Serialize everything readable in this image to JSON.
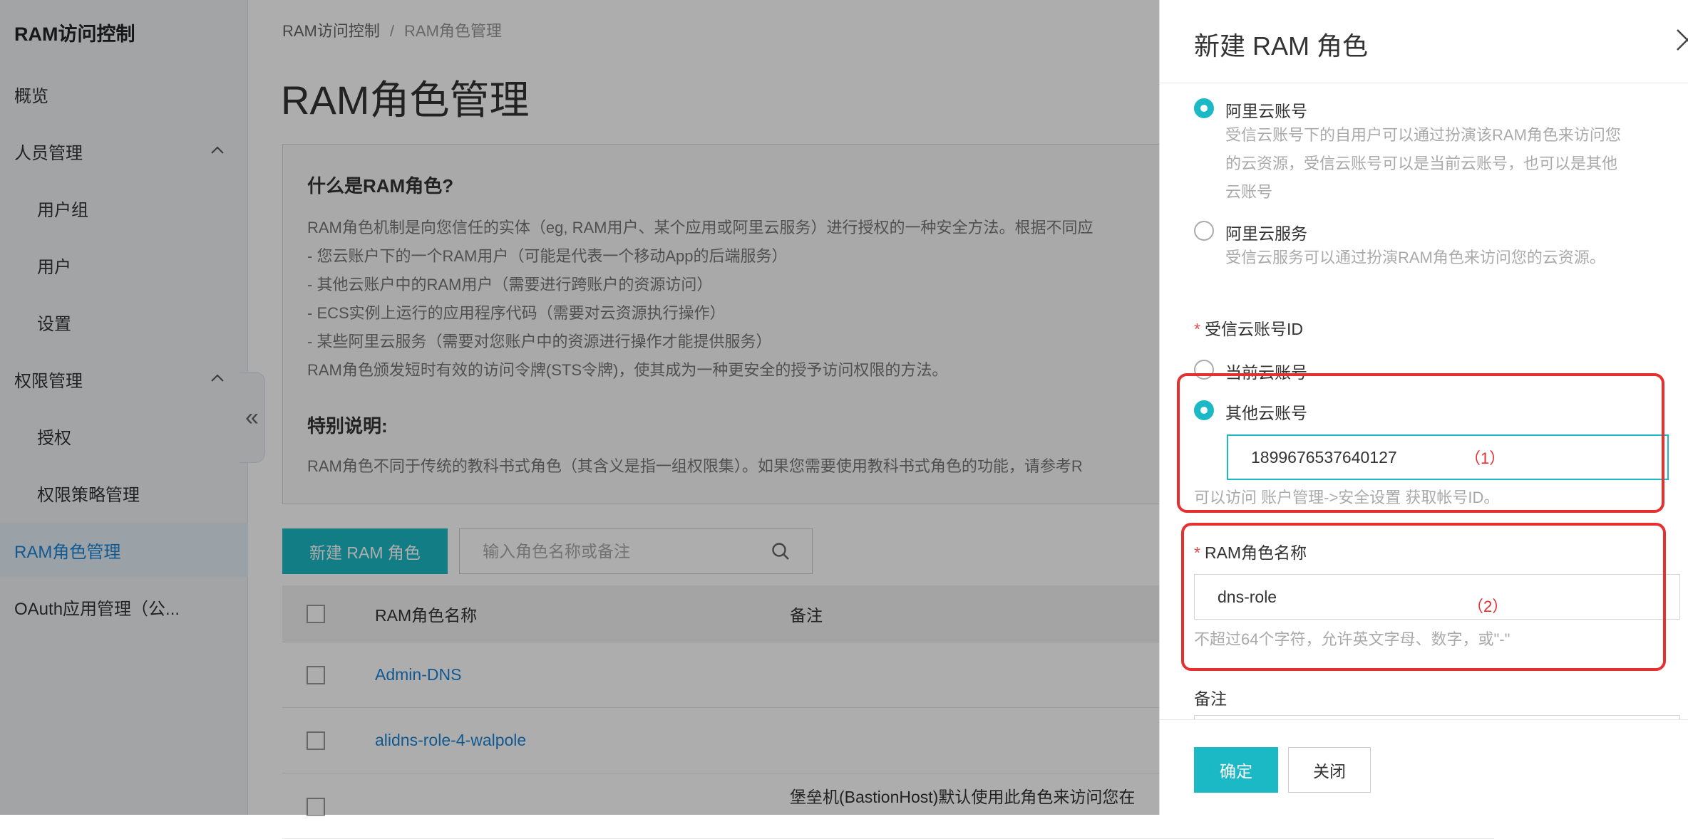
{
  "sidebar": {
    "title": "RAM访问控制",
    "items": [
      {
        "label": "概览"
      },
      {
        "label": "人员管理"
      },
      {
        "label": "用户组"
      },
      {
        "label": "用户"
      },
      {
        "label": "设置"
      },
      {
        "label": "权限管理"
      },
      {
        "label": "授权"
      },
      {
        "label": "权限策略管理"
      },
      {
        "label": "RAM角色管理"
      },
      {
        "label": "OAuth应用管理（公..."
      }
    ],
    "collapse_glyph": "«"
  },
  "breadcrumb": {
    "root": "RAM访问控制",
    "sep": "/",
    "current": "RAM角色管理"
  },
  "page_title": "RAM角色管理",
  "info": {
    "heading": "什么是RAM角色?",
    "lines": [
      "RAM角色机制是向您信任的实体（eg, RAM用户、某个应用或阿里云服务）进行授权的一种安全方法。根据不同应",
      "- 您云账户下的一个RAM用户（可能是代表一个移动App的后端服务）",
      "- 其他云账户中的RAM用户（需要进行跨账户的资源访问）",
      "- ECS实例上运行的应用程序代码（需要对云资源执行操作）",
      "- 某些阿里云服务（需要对您账户中的资源进行操作才能提供服务）",
      "RAM角色颁发短时有效的访问令牌(STS令牌)，使其成为一种更安全的授予访问权限的方法。"
    ],
    "special_heading": "特别说明:",
    "special_text": "RAM角色不同于传统的教科书式角色（其含义是指一组权限集）。如果您需要使用教科书式角色的功能，请参考R"
  },
  "toolbar": {
    "new_role": "新建 RAM 角色",
    "search_placeholder": "输入角色名称或备注"
  },
  "table": {
    "headers": {
      "name": "RAM角色名称",
      "note": "备注"
    },
    "rows": [
      {
        "name": "Admin-DNS",
        "note": ""
      },
      {
        "name": "alidns-role-4-walpole",
        "note": ""
      },
      {
        "name": "",
        "note": "堡垒机(BastionHost)默认使用此角色来访问您在"
      }
    ]
  },
  "drawer": {
    "title": "新建 RAM 角色",
    "trust_options": [
      {
        "label": "阿里云账号",
        "desc": [
          "受信云账号下的自用户可以通过扮演该RAM角色来访问您",
          "的云资源，受信云账号可以是当前云账号，也可以是其他",
          "云账号"
        ],
        "selected": true
      },
      {
        "label": "阿里云服务",
        "desc": [
          "受信云服务可以通过扮演RAM角色来访问您的云资源。"
        ],
        "selected": false
      }
    ],
    "account_id_label": "受信云账号ID",
    "account_options": [
      {
        "label": "当前云账号",
        "selected": false
      },
      {
        "label": "其他云账号",
        "selected": true
      }
    ],
    "account_id_value": "1899676537640127",
    "account_hint": "可以访问 账户管理->安全设置 获取帐号ID。",
    "role_name_label": "RAM角色名称",
    "role_name_value": "dns-role",
    "role_name_hint": "不超过64个字符，允许英文字母、数字，或\"-\"",
    "note_label": "备注",
    "required_mark": "*",
    "annotations": [
      "（1）",
      "（2）"
    ],
    "ok": "确定",
    "close": "关闭"
  },
  "colors": {
    "accent": "#1bb8c5",
    "link": "#1b84d6",
    "annotation": "#e62f2f"
  }
}
